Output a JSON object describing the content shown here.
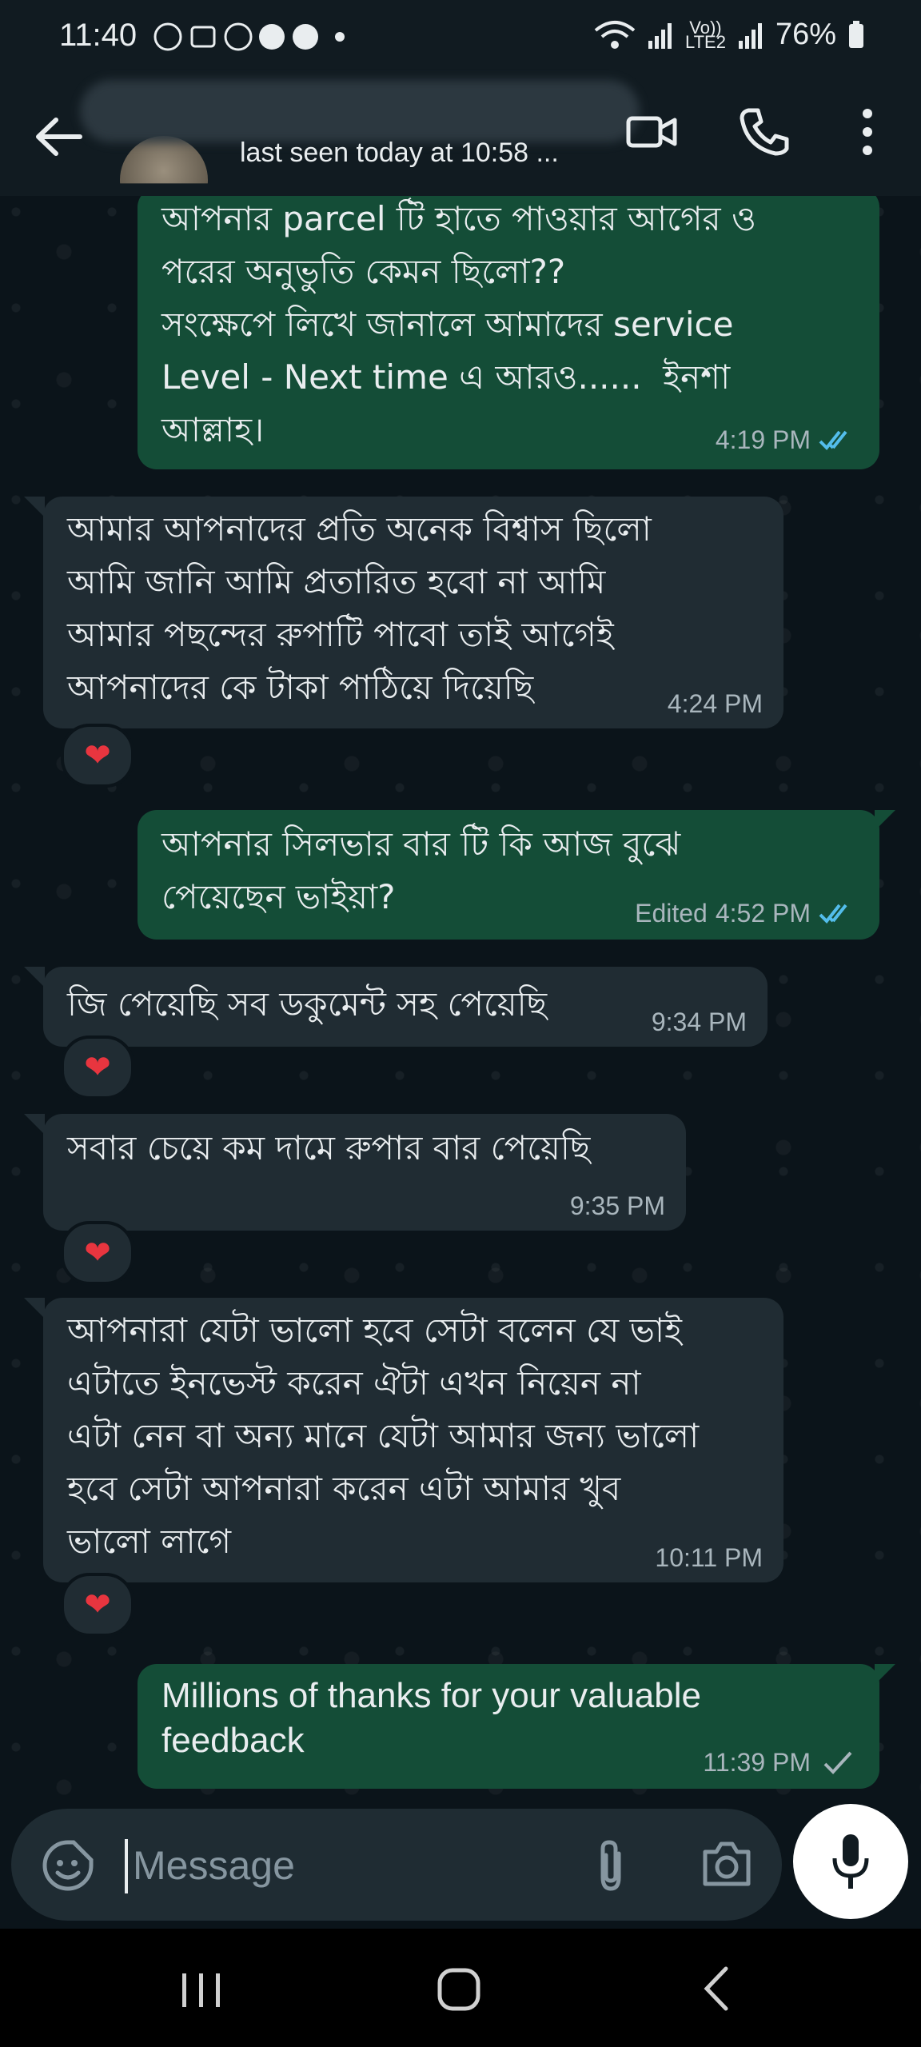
{
  "status_bar": {
    "time": "11:40",
    "network_label_top": "Vo))",
    "network_label_bottom": "LTE2",
    "battery": "76%"
  },
  "header": {
    "last_seen": "last seen today at 10:58 ..."
  },
  "messages": [
    {
      "direction": "outgoing",
      "text": "আপনার parcel টি হাতে পাওয়ার আগের ও\nপরের অনুভুতি কেমন ছিলো??\nসংক্ষেপে লিখে জানালে আমাদের service\nLevel - Next time এ আরও......  ইনশা\nআল্লাহ।",
      "time": "4:19 PM",
      "status": "read"
    },
    {
      "direction": "incoming",
      "text": "আমার আপনাদের প্রতি অনেক বিশ্বাস ছিলো\nআমি জানি আমি প্রতারিত হবো না আমি\nআমার পছন্দের রুপাটি পাবো তাই আগেই\nআপনাদের কে টাকা পাঠিয়ে দিয়েছি",
      "time": "4:24 PM",
      "reaction": "❤"
    },
    {
      "direction": "outgoing",
      "text": "আপনার সিলভার বার টি কি আজ বুঝে\nপেয়েছেন ভাইয়া?",
      "edited_label": "Edited",
      "time": "4:52 PM",
      "status": "read"
    },
    {
      "direction": "incoming",
      "text": "জি পেয়েছি সব ডকুমেন্ট সহ পেয়েছি",
      "time": "9:34 PM",
      "reaction": "❤"
    },
    {
      "direction": "incoming",
      "text": "সবার চেয়ে কম দামে রুপার বার পেয়েছি",
      "time": "9:35 PM",
      "reaction": "❤"
    },
    {
      "direction": "incoming",
      "text": "আপনারা যেটা ভালো হবে সেটা বলেন যে ভাই\nএটাতে ইনভেস্ট করেন ঐটা এখন নিয়েন না\nএটা নেন বা অন্য মানে যেটা আমার জন্য ভালো\nহবে সেটা আপনারা করেন এটা আমার খুব\nভালো লাগে",
      "time": "10:11 PM",
      "reaction": "❤"
    },
    {
      "direction": "outgoing",
      "text": "Millions of thanks for your valuable\nfeedback",
      "time": "11:39 PM",
      "status": "sent"
    }
  ],
  "composer": {
    "placeholder": "Message"
  },
  "colors": {
    "outgoing_bubble": "#144d37",
    "incoming_bubble": "#202c33",
    "read_tick": "#53bdeb",
    "background": "#0b141a"
  }
}
